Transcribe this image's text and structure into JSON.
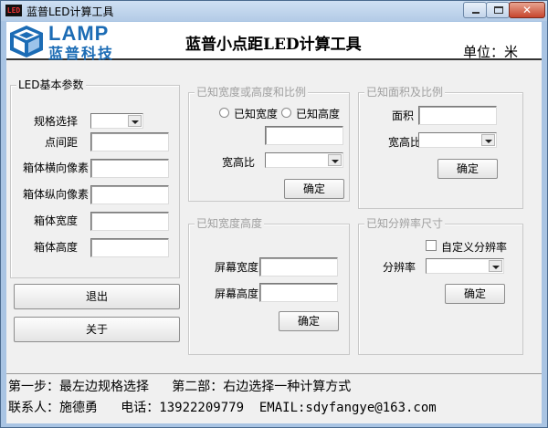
{
  "window": {
    "title": "蓝普LED计算工具",
    "icon_text": "LED"
  },
  "header": {
    "logo_word": "LAMP",
    "logo_cn": "蓝普科技",
    "title": "蓝普小点距LED计算工具",
    "unit": "单位：米"
  },
  "left_panel": {
    "legend": "LED基本参数",
    "fields": [
      {
        "label": "规格选择",
        "value": ""
      },
      {
        "label": "点间距",
        "value": ""
      },
      {
        "label": "箱体横向像素",
        "value": ""
      },
      {
        "label": "箱体纵向像素",
        "value": ""
      },
      {
        "label": "箱体宽度",
        "value": ""
      },
      {
        "label": "箱体高度",
        "value": ""
      }
    ],
    "exit_button": "退出",
    "about_button": "关于"
  },
  "panel_ratio": {
    "legend": "已知宽度或高度和比例",
    "radio_width": "已知宽度",
    "radio_height": "已知高度",
    "input_value": "",
    "ratio_label": "宽高比",
    "ratio_value": "",
    "confirm": "确定"
  },
  "panel_area": {
    "legend": "已知面积及比例",
    "area_label": "面积",
    "area_value": "",
    "ratio_label": "宽高比",
    "ratio_value": "",
    "confirm": "确定"
  },
  "panel_wh": {
    "legend": "已知宽度高度",
    "width_label": "屏幕宽度",
    "width_value": "",
    "height_label": "屏幕高度",
    "height_value": "",
    "confirm": "确定"
  },
  "panel_resolution": {
    "legend": "已知分辨率尺寸",
    "custom_label": "自定义分辨率",
    "resolution_label": "分辨率",
    "resolution_value": "",
    "confirm": "确定"
  },
  "footer": {
    "line1": "第一步：最左边规格选择   第二部：右边选择一种计算方式",
    "line2": "联系人：施德勇   电话：13922209779  EMAIL:sdyfangye@163.com"
  },
  "colors": {
    "logo_blue": "#1c6cb5",
    "titlebar": "#b3cbe6"
  }
}
